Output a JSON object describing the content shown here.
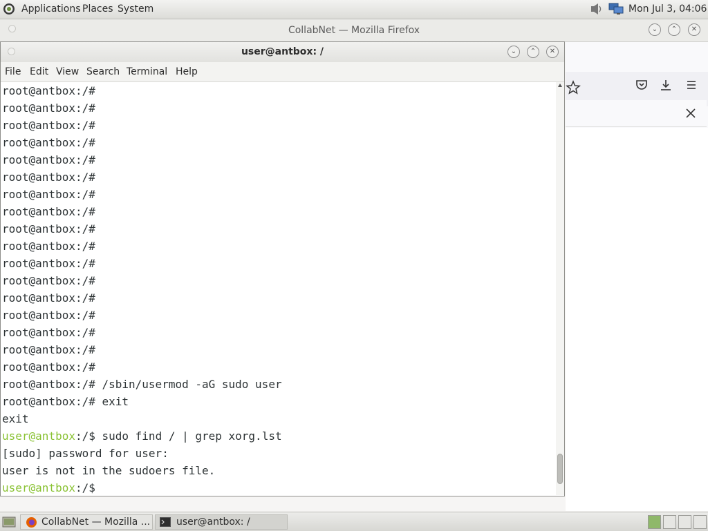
{
  "top_panel": {
    "menus": [
      "Applications",
      "Places",
      "System"
    ],
    "clock": "Mon Jul 3, 04:06"
  },
  "firefox": {
    "title": "CollabNet — Mozilla Firefox"
  },
  "terminal": {
    "title": "user@antbox: /",
    "menu": [
      "File",
      "Edit",
      "View",
      "Search",
      "Terminal",
      "Help"
    ],
    "lines": [
      {
        "prompt_user": "",
        "prompt_path": "",
        "text": "root@antbox:/#"
      },
      {
        "prompt_user": "",
        "prompt_path": "",
        "text": "root@antbox:/#"
      },
      {
        "prompt_user": "",
        "prompt_path": "",
        "text": "root@antbox:/#"
      },
      {
        "prompt_user": "",
        "prompt_path": "",
        "text": "root@antbox:/#"
      },
      {
        "prompt_user": "",
        "prompt_path": "",
        "text": "root@antbox:/#"
      },
      {
        "prompt_user": "",
        "prompt_path": "",
        "text": "root@antbox:/#"
      },
      {
        "prompt_user": "",
        "prompt_path": "",
        "text": "root@antbox:/#"
      },
      {
        "prompt_user": "",
        "prompt_path": "",
        "text": "root@antbox:/#"
      },
      {
        "prompt_user": "",
        "prompt_path": "",
        "text": "root@antbox:/#"
      },
      {
        "prompt_user": "",
        "prompt_path": "",
        "text": "root@antbox:/#"
      },
      {
        "prompt_user": "",
        "prompt_path": "",
        "text": "root@antbox:/#"
      },
      {
        "prompt_user": "",
        "prompt_path": "",
        "text": "root@antbox:/#"
      },
      {
        "prompt_user": "",
        "prompt_path": "",
        "text": "root@antbox:/#"
      },
      {
        "prompt_user": "",
        "prompt_path": "",
        "text": "root@antbox:/#"
      },
      {
        "prompt_user": "",
        "prompt_path": "",
        "text": "root@antbox:/#"
      },
      {
        "prompt_user": "",
        "prompt_path": "",
        "text": "root@antbox:/#"
      },
      {
        "prompt_user": "",
        "prompt_path": "",
        "text": "root@antbox:/#"
      },
      {
        "prompt_user": "",
        "prompt_path": "",
        "text": "root@antbox:/# /sbin/usermod -aG sudo user"
      },
      {
        "prompt_user": "",
        "prompt_path": "",
        "text": "root@antbox:/# exit"
      },
      {
        "prompt_user": "",
        "prompt_path": "",
        "text": "exit"
      },
      {
        "prompt_user": "user@antbox",
        "prompt_path": ":/$ ",
        "text": "sudo find / | grep xorg.lst"
      },
      {
        "prompt_user": "",
        "prompt_path": "",
        "text": "[sudo] password for user:"
      },
      {
        "prompt_user": "",
        "prompt_path": "",
        "text": "user is not in the sudoers file."
      },
      {
        "prompt_user": "user@antbox",
        "prompt_path": ":/$ ",
        "text": ""
      }
    ],
    "prompt_color": "#8ac234"
  },
  "taskbar": {
    "tasks": [
      "CollabNet — Mozilla ...",
      "user@antbox: /"
    ]
  }
}
